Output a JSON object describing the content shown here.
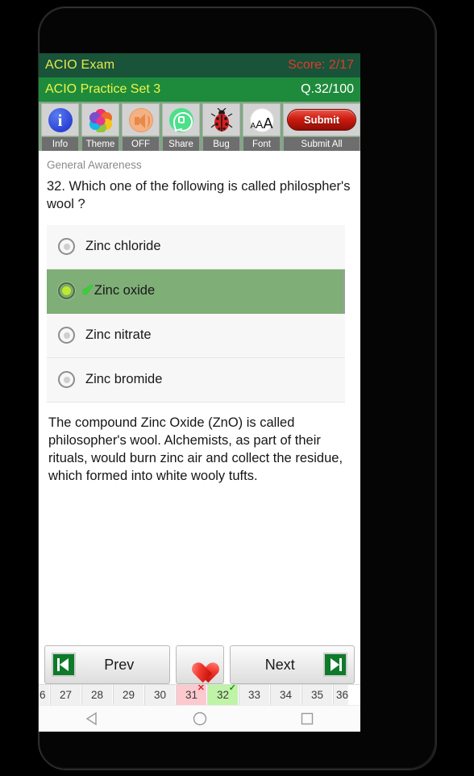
{
  "header": {
    "app_title": "ACIO Exam",
    "score_label": "Score: 2/17",
    "set_title": "ACIO Practice Set 3",
    "question_counter": "Q.32/100",
    "title_bar_color": "#18533a",
    "sub_bar_color": "#1e8b3c",
    "title_text_color": "#e8e84a",
    "score_text_color": "#e03b2a"
  },
  "toolbar": {
    "items": [
      {
        "icon": "info-icon",
        "label": "Info"
      },
      {
        "icon": "theme-palette-icon",
        "label": "Theme"
      },
      {
        "icon": "speaker-off-icon",
        "label": "OFF"
      },
      {
        "icon": "whatsapp-share-icon",
        "label": "Share"
      },
      {
        "icon": "ladybug-icon",
        "label": "Bug"
      },
      {
        "icon": "font-size-icon",
        "label": "Font"
      }
    ],
    "submit_button": "Submit",
    "submit_label": "Submit All",
    "submit_color": "#cf1c10"
  },
  "question": {
    "subject": "General Awareness",
    "text": "32. Which one of the following is called philospher's wool ?",
    "options": [
      {
        "text": "Zinc chloride",
        "selected": false,
        "correct": false
      },
      {
        "text": "Zinc oxide",
        "selected": true,
        "correct": true
      },
      {
        "text": "Zinc nitrate",
        "selected": false,
        "correct": false
      },
      {
        "text": "Zinc bromide",
        "selected": false,
        "correct": false
      }
    ],
    "selected_bg_color": "#7fae77",
    "check_mark": "✔",
    "explanation": "The compound Zinc Oxide (ZnO) is called philosopher's wool. Alchemists, as part of their rituals, would burn zinc air and collect the residue, which formed into white wooly tufts."
  },
  "nav": {
    "prev_label": "Prev",
    "next_label": "Next",
    "favourite_icon": "heart-icon",
    "first_icon": "skip-to-first-icon",
    "last_icon": "skip-to-last-icon"
  },
  "question_strip": {
    "cells": [
      {
        "number": "6",
        "state": "partial-left",
        "mark": ""
      },
      {
        "number": "27",
        "state": "none",
        "mark": ""
      },
      {
        "number": "28",
        "state": "none",
        "mark": ""
      },
      {
        "number": "29",
        "state": "none",
        "mark": ""
      },
      {
        "number": "30",
        "state": "none",
        "mark": ""
      },
      {
        "number": "31",
        "state": "wrong",
        "mark": "✕"
      },
      {
        "number": "32",
        "state": "right",
        "mark": "✓"
      },
      {
        "number": "33",
        "state": "none",
        "mark": ""
      },
      {
        "number": "34",
        "state": "none",
        "mark": ""
      },
      {
        "number": "35",
        "state": "none",
        "mark": ""
      },
      {
        "number": "36",
        "state": "partial-right",
        "mark": ""
      }
    ],
    "wrong_color": "#fcc9cf",
    "right_color": "#bff3a6"
  },
  "system_nav": {
    "back": "back-triangle-icon",
    "home": "home-circle-icon",
    "recents": "recents-square-icon"
  }
}
